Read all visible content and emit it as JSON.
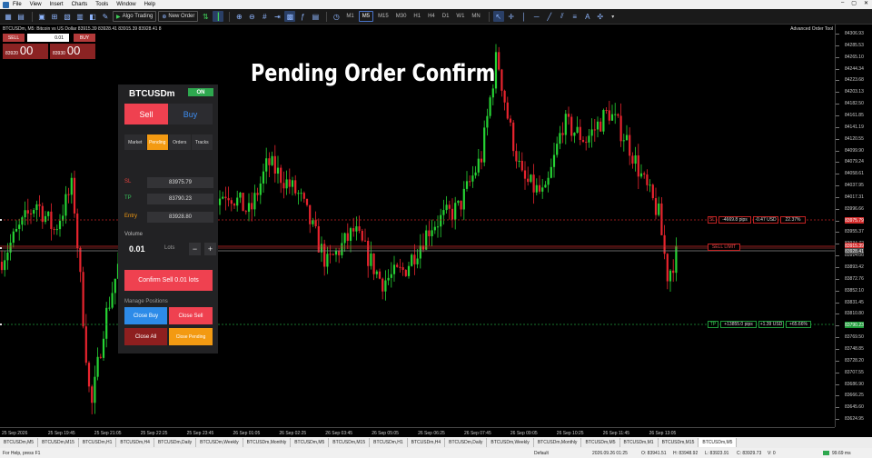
{
  "menu": {
    "items": [
      "File",
      "View",
      "Insert",
      "Charts",
      "Tools",
      "Window",
      "Help"
    ]
  },
  "toolbar": {
    "algo_trading": "Algo Trading",
    "new_order": "New Order",
    "timeframes": [
      "M1",
      "M5",
      "M15",
      "M30",
      "H1",
      "H4",
      "D1",
      "W1",
      "MN"
    ],
    "active_timeframe": "M5"
  },
  "chart": {
    "title": "BTCUSDm, M5:  Bitcoin vs US Dollar  83915.39 83928.41 83915.39 83928.41  8",
    "advanced_tool": "Advanced Order Tool",
    "banner": "Pending Order Confirm",
    "price_labels": [
      "84306.93",
      "84285.53",
      "84265.10",
      "84244.34",
      "84223.68",
      "84203.13",
      "84182.50",
      "84161.85",
      "84141.19",
      "84120.55",
      "84099.90",
      "84079.24",
      "84058.61",
      "84037.95",
      "84017.31",
      "83996.66",
      "83976.01",
      "83955.37",
      "83934.72",
      "83914.06",
      "83893.42",
      "83872.76",
      "83852.10",
      "83831.45",
      "83810.80",
      "83790.15",
      "83769.50",
      "83748.85",
      "83728.20",
      "83707.55",
      "83686.90",
      "83666.25",
      "83645.60",
      "83624.95"
    ],
    "time_labels": [
      "25 Sep 2026",
      "25 Sep 19:45",
      "25 Sep 21:05",
      "25 Sep 22:25",
      "25 Sep 23:45",
      "26 Sep 01:05",
      "26 Sep 02:25",
      "26 Sep 03:45",
      "26 Sep 05:05",
      "26 Sep 06:25",
      "26 Sep 07:45",
      "26 Sep 09:05",
      "26 Sep 10:25",
      "26 Sep 11:45",
      "26 Sep 13:05"
    ],
    "sl_line": {
      "tag": "SL",
      "pips": "-4669.8 pips",
      "money": "-0.47 USD",
      "percent": "22.37%",
      "price": "83975.79"
    },
    "entry_line": {
      "tag": "SELL LIMIT",
      "price": "83928.80"
    },
    "tp_line": {
      "tag": "TP",
      "pips": "+13855.0 pips",
      "money": "+1.39 USD",
      "percent": "+65.66%",
      "price": "83790.23"
    },
    "bid_tag": "83915.39",
    "ask_tag": "83928.41"
  },
  "oneclick": {
    "sell": "SELL",
    "buy": "BUY",
    "volume": "0.01",
    "sell_price_small": "83920",
    "sell_price_big": "00",
    "buy_price_small": "83930",
    "buy_price_big": "00"
  },
  "panel": {
    "symbol": "BTCUSDm",
    "status": "ON",
    "sell": "Sell",
    "buy": "Buy",
    "tabs": [
      "Market",
      "Pending",
      "Orders",
      "Tracks"
    ],
    "active_tab": "Pending",
    "sl_label": "SL",
    "sl_value": "83975.79",
    "tp_label": "TP",
    "tp_value": "83790.23",
    "entry_label": "Entry",
    "entry_value": "83928.80",
    "volume_label": "Volume",
    "volume_value": "0.01",
    "volume_unit": "Lots",
    "minus": "−",
    "plus": "+",
    "confirm": "Confirm Sell 0.01 lots",
    "manage_label": "Manage Positions",
    "close_buy": "Close Buy",
    "close_sell": "Close Sell",
    "close_all": "Close All",
    "close_pending": "Close Pending"
  },
  "symbol_tabs": [
    "BTCUSDm,M5",
    "BTCUSDm,M15",
    "BTCUSDm,H1",
    "BTCUSDm,H4",
    "BTCUSDm,Daily",
    "BTCUSDm,Weekly",
    "BTCUSDm,Monthly",
    "BTCUSDm,M5",
    "BTCUSDm,M15",
    "BTCUSDm,H1",
    "BTCUSDm,H4",
    "BTCUSDm,Daily",
    "BTCUSDm,Weekly",
    "BTCUSDm,Monthly",
    "BTCUSDm,M5",
    "BTCUSDm,M1",
    "BTCUSDm,M15",
    "BTCUSDm,M5"
  ],
  "status": {
    "help": "For Help, press F1",
    "profile": "Default",
    "datetime": "2026.09.26 01:25",
    "open": "O: 83941.51",
    "high": "H: 83948.92",
    "low": "L: 83923.91",
    "close": "C: 83929.73",
    "volume": "V: 0",
    "ping": "99.69 ms"
  },
  "colors": {
    "bull": "#26d334",
    "bear": "#e8242e",
    "sl": "#d22b2b",
    "tp": "#1f9b3a",
    "accent": "#ef4150"
  }
}
